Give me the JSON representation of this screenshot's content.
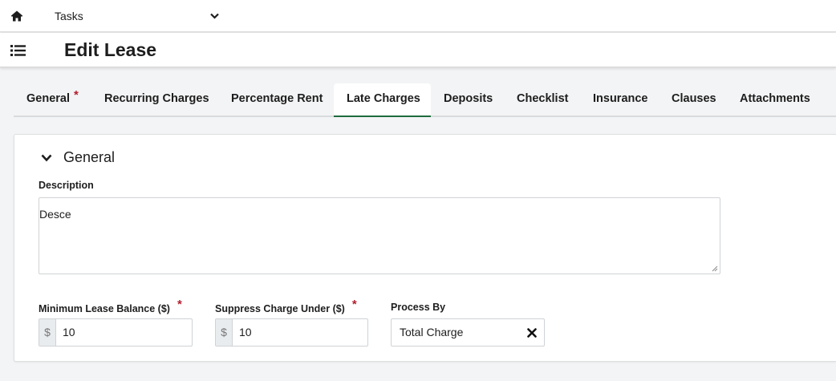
{
  "topbar": {
    "home_icon": "home-icon",
    "tasks_select": {
      "value": "Tasks",
      "icon": "chevron-down-icon"
    }
  },
  "header": {
    "menu_icon": "list-menu-icon",
    "title": "Edit Lease"
  },
  "tabs": [
    {
      "label": "General",
      "required": true,
      "active": false
    },
    {
      "label": "Recurring Charges",
      "active": false
    },
    {
      "label": "Percentage Rent",
      "active": false
    },
    {
      "label": "Late Charges",
      "active": true
    },
    {
      "label": "Deposits",
      "active": false
    },
    {
      "label": "Checklist",
      "active": false
    },
    {
      "label": "Insurance",
      "active": false
    },
    {
      "label": "Clauses",
      "active": false
    },
    {
      "label": "Attachments",
      "active": false
    }
  ],
  "section": {
    "title": "General",
    "expanded": true,
    "description": {
      "label": "Description",
      "value": "Desce"
    },
    "min_lease_balance": {
      "label": "Minimum Lease Balance ($)",
      "required": true,
      "prefix": "$",
      "value": "10"
    },
    "suppress_charge_under": {
      "label": "Suppress Charge Under ($)",
      "required": true,
      "prefix": "$",
      "value": "10"
    },
    "process_by": {
      "label": "Process By",
      "value": "Total Charge",
      "clear_icon": "close-icon"
    }
  },
  "colors": {
    "active_tab_underline": "#1e6b3c",
    "required_star": "#b11f2f",
    "page_background": "#f3f4f5"
  }
}
